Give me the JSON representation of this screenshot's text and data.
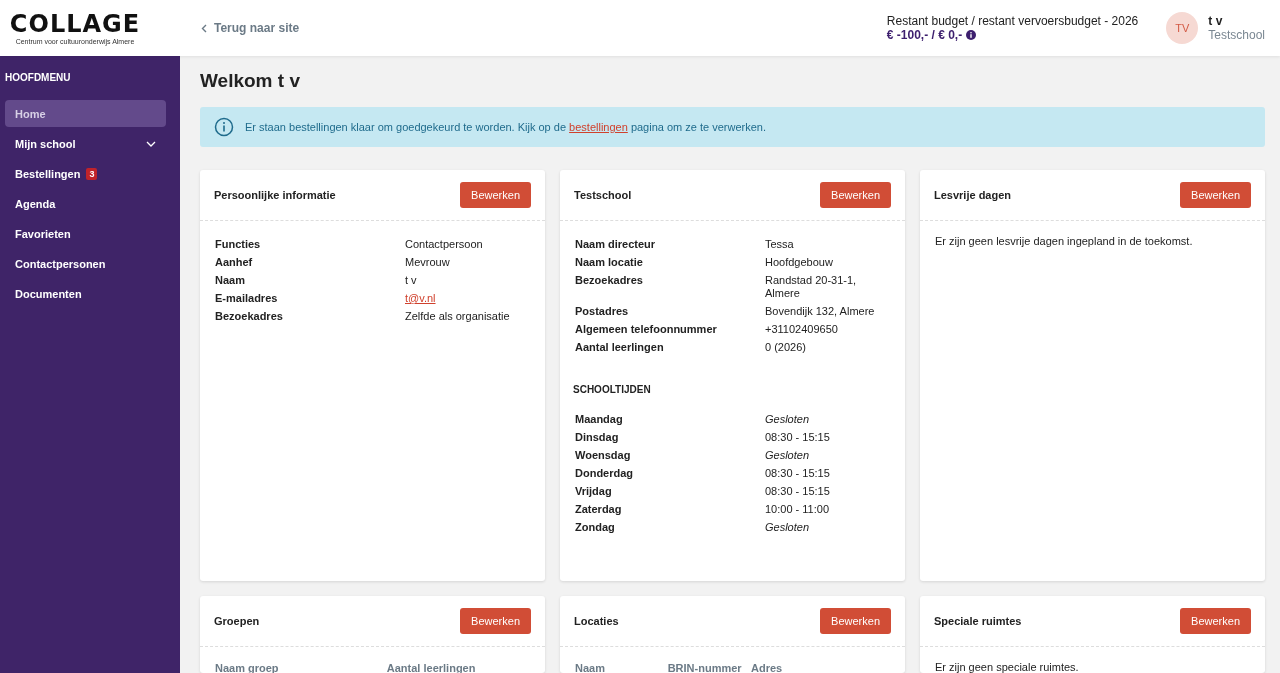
{
  "header": {
    "logo": {
      "wordmark": "COLLAGE",
      "tagline": "Centrum voor cultuuronderwijs Almere"
    },
    "back_link": "Terug naar site",
    "budget": {
      "label": "Restant budget / restant vervoersbudget - 2026",
      "amount": "€ -100,- / € 0,-"
    },
    "user": {
      "initials": "TV",
      "name": "t v",
      "school": "Testschool"
    }
  },
  "sidebar": {
    "heading": "HOOFDMENU",
    "items": [
      {
        "label": "Home",
        "selected": true
      },
      {
        "label": "Mijn school",
        "selected": false,
        "expandable": true
      },
      {
        "label": "Bestellingen",
        "selected": false,
        "badge": "3"
      },
      {
        "label": "Agenda",
        "selected": false
      },
      {
        "label": "Favorieten",
        "selected": false
      },
      {
        "label": "Contactpersonen",
        "selected": false
      },
      {
        "label": "Documenten",
        "selected": false
      }
    ]
  },
  "page_title": "Welkom t v",
  "alert": {
    "text_before": "Er staan bestellingen klaar om goedgekeurd te worden. Kijk op de",
    "link": "bestellingen",
    "text_after": "pagina om ze te verwerken."
  },
  "cards": [
    {
      "kind": "details",
      "title": "Persoonlijke informatie",
      "button": "Bewerken",
      "rows": [
        {
          "label": "Functies",
          "value": "Contactpersoon"
        },
        {
          "label": "Aanhef",
          "value": "Mevrouw"
        },
        {
          "label": "Naam",
          "value": "t v"
        },
        {
          "label": "E-mailadres",
          "value": "t@v.nl",
          "link": true
        },
        {
          "label": "Bezoekadres",
          "value": "Zelfde als organisatie"
        }
      ]
    },
    {
      "kind": "details",
      "title": "Testschool",
      "button": "Bewerken",
      "rows": [
        {
          "label": "Naam directeur",
          "value": "Tessa"
        },
        {
          "label": "Naam locatie",
          "value": "Hoofdgebouw"
        },
        {
          "label": "Bezoekadres",
          "value": "Randstad 20-31-1, Almere"
        },
        {
          "label": "Postadres",
          "value": "Bovendijk 132, Almere"
        },
        {
          "label": "Algemeen telefoonnummer",
          "value": "+31102409650"
        },
        {
          "label": "Aantal leerlingen",
          "value": "0 (2026)"
        }
      ],
      "section": {
        "heading": "SCHOOLTIJDEN",
        "rows": [
          {
            "label": "Maandag",
            "value": "Gesloten",
            "closed": true
          },
          {
            "label": "Dinsdag",
            "value": "08:30 - 15:15",
            "closed": false
          },
          {
            "label": "Woensdag",
            "value": "Gesloten",
            "closed": true
          },
          {
            "label": "Donderdag",
            "value": "08:30 - 15:15",
            "closed": false
          },
          {
            "label": "Vrijdag",
            "value": "08:30 - 15:15",
            "closed": false
          },
          {
            "label": "Zaterdag",
            "value": "10:00 - 11:00",
            "closed": false
          },
          {
            "label": "Zondag",
            "value": "Gesloten",
            "closed": true
          }
        ]
      }
    },
    {
      "kind": "empty",
      "title": "Lesvrije dagen",
      "button": "Bewerken",
      "message": "Er zijn geen lesvrije dagen ingepland in de toekomst."
    },
    {
      "kind": "table",
      "title": "Groepen",
      "button": "Bewerken",
      "columns": [
        "Naam groep",
        "Aantal leerlingen"
      ]
    },
    {
      "kind": "table",
      "title": "Locaties",
      "button": "Bewerken",
      "columns": [
        "Naam",
        "BRIN-nummer",
        "Adres"
      ]
    },
    {
      "kind": "empty",
      "title": "Speciale ruimtes",
      "button": "Bewerken",
      "message": "Er zijn geen speciale ruimtes."
    }
  ]
}
